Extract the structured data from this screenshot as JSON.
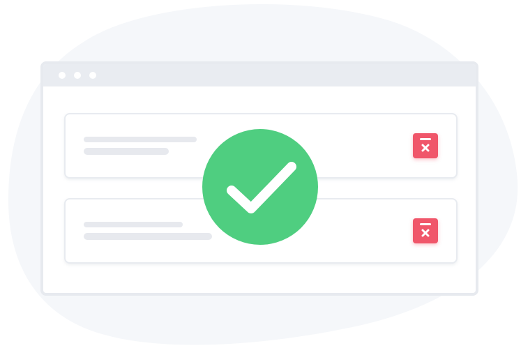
{
  "illustration": {
    "window": {
      "title_dots": 3
    },
    "list": {
      "items": [
        {
          "delete_icon": "trash-delete-icon"
        },
        {
          "delete_icon": "trash-delete-icon"
        }
      ]
    },
    "status_icon": "checkmark-icon"
  },
  "colors": {
    "background_blob": "#f5f7fa",
    "window_frame": "#e7eaef",
    "placeholder_line": "#e7e9ee",
    "delete_accent": "#f0566a",
    "success_accent": "#4fce80"
  }
}
